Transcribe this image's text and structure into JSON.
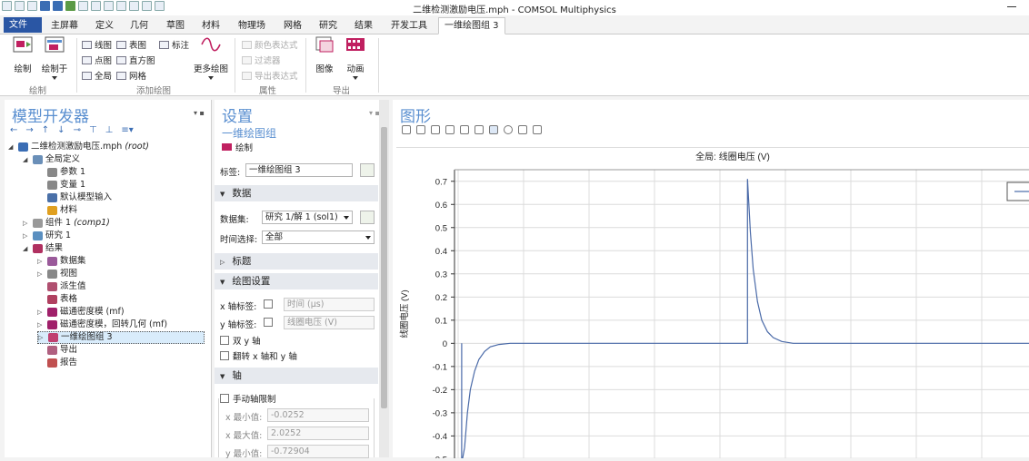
{
  "window": {
    "title": "二维检测激励电压.mph - COMSOL Multiphysics"
  },
  "menu": {
    "file": "文件",
    "tabs": [
      "主屏幕",
      "定义",
      "几何",
      "草图",
      "材料",
      "物理场",
      "网格",
      "研究",
      "结果",
      "开发工具",
      "一维绘图组 3"
    ]
  },
  "ribbon": {
    "plot": "绘制",
    "plot_in": "绘制于",
    "line_graph": "线图",
    "table_graph": "表图",
    "annotation": "标注",
    "point_graph": "点图",
    "histogram": "直方图",
    "global": "全局",
    "mesh": "网格",
    "more_plots": "更多绘图",
    "color_expr": "颜色表达式",
    "filter": "过滤器",
    "export_expr": "导出表达式",
    "image": "图像",
    "animation": "动画",
    "group_plot": "绘制",
    "group_add_plot": "添加绘图",
    "group_attributes": "属性",
    "group_export": "导出"
  },
  "model_builder": {
    "title": "模型开发器",
    "tree": [
      {
        "label": "二维检测激励电压.mph",
        "suffix": "(root)",
        "level": 0,
        "toggle": "◢",
        "color": "#3a6db4"
      },
      {
        "label": "全局定义",
        "suffix": "",
        "level": 1,
        "toggle": "◢",
        "color": "#6a8fb8"
      },
      {
        "label": "参数 1",
        "suffix": "",
        "level": 2,
        "toggle": "",
        "color": "#888"
      },
      {
        "label": "变量 1",
        "suffix": "",
        "level": 2,
        "toggle": "",
        "color": "#888"
      },
      {
        "label": "默认模型输入",
        "suffix": "",
        "level": 2,
        "toggle": "",
        "color": "#4a70a8"
      },
      {
        "label": "材料",
        "suffix": "",
        "level": 2,
        "toggle": "",
        "color": "#e0a020"
      },
      {
        "label": "组件 1",
        "suffix": "(comp1)",
        "level": 1,
        "toggle": "▷",
        "color": "#999"
      },
      {
        "label": "研究 1",
        "suffix": "",
        "level": 1,
        "toggle": "▷",
        "color": "#5a8fc0"
      },
      {
        "label": "结果",
        "suffix": "",
        "level": 1,
        "toggle": "◢",
        "color": "#b03060"
      },
      {
        "label": "数据集",
        "suffix": "",
        "level": 2,
        "toggle": "▷",
        "color": "#9a5a9a"
      },
      {
        "label": "视图",
        "suffix": "",
        "level": 2,
        "toggle": "▷",
        "color": "#888"
      },
      {
        "label": "派生值",
        "suffix": "",
        "level": 2,
        "toggle": "",
        "color": "#b05070"
      },
      {
        "label": "表格",
        "suffix": "",
        "level": 2,
        "toggle": "",
        "color": "#b04060"
      },
      {
        "label": "磁通密度模 (mf)",
        "suffix": "",
        "level": 2,
        "toggle": "▷",
        "color": "#a0206a"
      },
      {
        "label": "磁通密度模，回转几何 (mf)",
        "suffix": "",
        "level": 2,
        "toggle": "▷",
        "color": "#a0206a"
      },
      {
        "label": "一维绘图组 3",
        "suffix": "",
        "level": 2,
        "toggle": "▷",
        "color": "#c04070",
        "selected": true
      },
      {
        "label": "导出",
        "suffix": "",
        "level": 2,
        "toggle": "",
        "color": "#b06080"
      },
      {
        "label": "报告",
        "suffix": "",
        "level": 2,
        "toggle": "",
        "color": "#c05050"
      }
    ]
  },
  "settings": {
    "title": "设置",
    "subtitle": "一维绘图组",
    "plot_btn": "绘制",
    "label_caption": "标签:",
    "label_value": "一维绘图组 3",
    "sec_data": "数据",
    "dataset_caption": "数据集:",
    "dataset_value": "研究 1/解 1 (sol1)",
    "time_caption": "时间选择:",
    "time_value": "全部",
    "sec_title": "标题",
    "sec_plot_settings": "绘图设置",
    "xlabel_caption": "x 轴标签:",
    "xlabel_value": "时间 (µs)",
    "ylabel_caption": "y 轴标签:",
    "ylabel_value": "线圈电压 (V)",
    "dual_y": "双 y 轴",
    "flip_xy": "翻转 x 轴和 y 轴",
    "sec_axis": "轴",
    "manual_axis": "手动轴限制",
    "xmin_caption": "x 最小值:",
    "xmin_value": "-0.0252",
    "xmax_caption": "x 最大值:",
    "xmax_value": "2.0252",
    "ymin_caption": "y 最小值:",
    "ymin_value": "-0.72904"
  },
  "graphics": {
    "title": "图形"
  },
  "chart_data": {
    "type": "line",
    "title": "全局: 线圈电压 (V)",
    "ylabel": "线圈电压 (V)",
    "xlim": [
      -0.0252,
      2.0252
    ],
    "ylim": [
      -0.52,
      0.75
    ],
    "yticks": [
      "0.7",
      "0.6",
      "0.5",
      "0.4",
      "0.3",
      "0.2",
      "0.1",
      "0",
      "-0.1",
      "-0.2",
      "-0.3",
      "-0.4",
      "-0.5"
    ],
    "ytick_values": [
      0.7,
      0.6,
      0.5,
      0.4,
      0.3,
      0.2,
      0.1,
      0,
      -0.1,
      -0.2,
      -0.3,
      -0.4,
      -0.5
    ],
    "grid": true,
    "series": [
      {
        "color": "#4a6aa8",
        "points": [
          [
            0.0,
            0.0
          ],
          [
            0.0,
            -0.52
          ],
          [
            0.01,
            -0.45
          ],
          [
            0.02,
            -0.3
          ],
          [
            0.03,
            -0.2
          ],
          [
            0.045,
            -0.12
          ],
          [
            0.06,
            -0.07
          ],
          [
            0.08,
            -0.035
          ],
          [
            0.1,
            -0.015
          ],
          [
            0.13,
            -0.005
          ],
          [
            0.17,
            0.0
          ],
          [
            1.0,
            0.0
          ],
          [
            1.0,
            0.71
          ],
          [
            1.01,
            0.48
          ],
          [
            1.02,
            0.32
          ],
          [
            1.035,
            0.18
          ],
          [
            1.05,
            0.1
          ],
          [
            1.07,
            0.05
          ],
          [
            1.09,
            0.025
          ],
          [
            1.12,
            0.008
          ],
          [
            1.16,
            0.0
          ],
          [
            2.0252,
            0.0
          ]
        ]
      }
    ]
  }
}
